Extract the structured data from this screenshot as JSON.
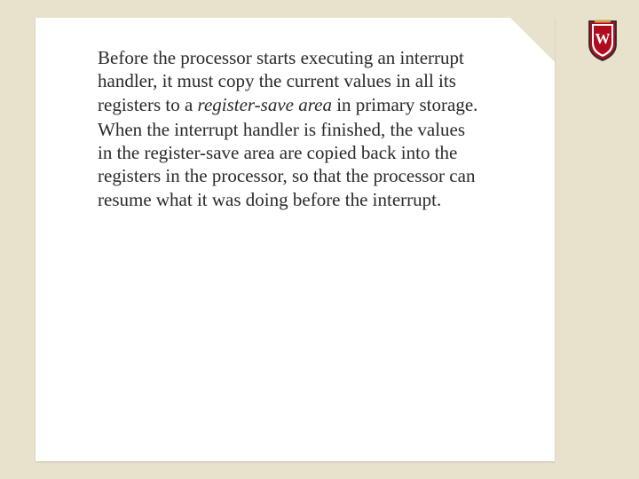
{
  "paragraphs": {
    "p1_pre": "Before the processor starts executing an interrupt handler, it must copy the current values in all its registers to a ",
    "p1_em": "register-save area",
    "p1_post": " in primary storage.",
    "p2": "When the interrupt handler is finished, the values in the register-save area are copied back into the registers in the processor, so that the processor can resume what it was doing before the interrupt."
  },
  "crest": {
    "letter": "W",
    "colors": {
      "shield": "#b10c1e",
      "border": "#2b2b2b",
      "inner": "#ffffff",
      "gold": "#cda349"
    }
  }
}
